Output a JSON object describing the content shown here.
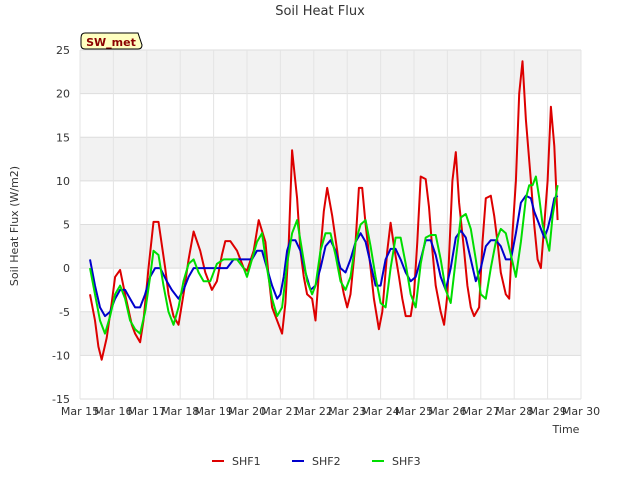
{
  "chart_data": {
    "type": "line",
    "title": "Soil Heat Flux",
    "badge": "SW_met",
    "xlabel": "Time",
    "ylabel": "Soil Heat Flux (W/m2)",
    "xlim": [
      15,
      30
    ],
    "ylim": [
      -15,
      25
    ],
    "x_ticks": [
      15,
      16,
      17,
      18,
      19,
      20,
      21,
      22,
      23,
      24,
      25,
      26,
      27,
      28,
      29,
      30
    ],
    "x_tick_labels": [
      "Mar 15",
      "Mar 16",
      "Mar 17",
      "Mar 18",
      "Mar 19",
      "Mar 20",
      "Mar 21",
      "Mar 22",
      "Mar 23",
      "Mar 24",
      "Mar 25",
      "Mar 26",
      "Mar 27",
      "Mar 28",
      "Mar 29",
      "Mar 30"
    ],
    "y_ticks": [
      -15,
      -10,
      -5,
      0,
      5,
      10,
      15,
      20,
      25
    ],
    "y_tick_labels": [
      "-15",
      "-10",
      "-5",
      "0",
      "5",
      "10",
      "15",
      "20",
      "25"
    ],
    "grid": true,
    "legend_position": "bottom-center",
    "series": [
      {
        "name": "SHF1",
        "color": "#dd0000",
        "x": [
          15.3,
          15.45,
          15.55,
          15.65,
          15.8,
          15.95,
          16.05,
          16.2,
          16.35,
          16.55,
          16.65,
          16.8,
          16.9,
          17.05,
          17.2,
          17.35,
          17.55,
          17.65,
          17.8,
          17.95,
          18.1,
          18.25,
          18.4,
          18.6,
          18.75,
          18.95,
          19.1,
          19.25,
          19.35,
          19.5,
          19.7,
          19.9,
          20.0,
          20.2,
          20.35,
          20.55,
          20.65,
          20.75,
          20.9,
          21.05,
          21.15,
          21.25,
          21.35,
          21.5,
          21.6,
          21.7,
          21.8,
          21.95,
          22.05,
          22.2,
          22.3,
          22.4,
          22.55,
          22.7,
          22.8,
          22.9,
          23.0,
          23.1,
          23.25,
          23.35,
          23.45,
          23.55,
          23.7,
          23.8,
          23.95,
          24.05,
          24.2,
          24.3,
          24.4,
          24.55,
          24.65,
          24.75,
          24.9,
          25.0,
          25.1,
          25.2,
          25.35,
          25.45,
          25.55,
          25.65,
          25.8,
          25.9,
          26.0,
          26.15,
          26.25,
          26.35,
          26.5,
          26.6,
          26.7,
          26.8,
          26.95,
          27.05,
          27.15,
          27.3,
          27.4,
          27.5,
          27.6,
          27.75,
          27.85,
          27.95,
          28.05,
          28.15,
          28.25,
          28.35,
          28.5,
          28.6,
          28.7,
          28.8,
          28.9,
          29.0,
          29.1,
          29.2,
          29.3
        ],
        "y": [
          -3.0,
          -6.0,
          -9.0,
          -10.5,
          -8.0,
          -4.0,
          -1.0,
          -0.2,
          -3.0,
          -6.5,
          -7.5,
          -8.5,
          -6.0,
          0.0,
          5.3,
          5.3,
          0.0,
          -3.0,
          -5.5,
          -6.5,
          -3.0,
          1.0,
          4.2,
          2.0,
          -0.5,
          -2.5,
          -1.5,
          1.5,
          3.1,
          3.1,
          2.0,
          0.0,
          -0.3,
          2.0,
          5.5,
          3.0,
          -1.0,
          -4.5,
          -6.0,
          -7.5,
          -4.0,
          3.0,
          13.5,
          8.0,
          2.0,
          -1.0,
          -3.0,
          -3.5,
          -6.0,
          2.0,
          6.5,
          9.2,
          6.0,
          2.0,
          -1.0,
          -3.0,
          -4.5,
          -3.0,
          3.0,
          9.2,
          9.2,
          5.0,
          0.0,
          -3.5,
          -7.0,
          -5.0,
          2.0,
          5.2,
          2.5,
          -1.0,
          -3.5,
          -5.5,
          -5.5,
          -3.0,
          3.0,
          10.5,
          10.2,
          7.0,
          2.0,
          -2.0,
          -5.0,
          -6.5,
          -3.0,
          10.0,
          13.3,
          7.5,
          2.0,
          -2.0,
          -4.5,
          -5.5,
          -4.5,
          3.0,
          8.0,
          8.3,
          6.0,
          3.0,
          -0.5,
          -3.0,
          -3.5,
          4.0,
          10.0,
          20.0,
          23.7,
          17.0,
          10.0,
          5.0,
          1.0,
          0.0,
          5.0,
          10.0,
          18.5,
          14.0,
          5.5
        ]
      },
      {
        "name": "SHF2",
        "color": "#0000cc",
        "x": [
          15.3,
          15.45,
          15.6,
          15.75,
          15.9,
          16.05,
          16.2,
          16.35,
          16.5,
          16.65,
          16.8,
          16.95,
          17.1,
          17.25,
          17.4,
          17.6,
          17.75,
          17.95,
          18.1,
          18.25,
          18.4,
          18.6,
          18.8,
          19.0,
          19.2,
          19.4,
          19.6,
          19.8,
          20.0,
          20.15,
          20.3,
          20.45,
          20.6,
          20.75,
          20.9,
          21.0,
          21.1,
          21.2,
          21.3,
          21.45,
          21.6,
          21.75,
          21.9,
          22.05,
          22.2,
          22.35,
          22.5,
          22.65,
          22.8,
          22.95,
          23.1,
          23.25,
          23.4,
          23.55,
          23.7,
          23.85,
          24.0,
          24.15,
          24.3,
          24.45,
          24.6,
          24.75,
          24.9,
          25.05,
          25.2,
          25.35,
          25.5,
          25.65,
          25.8,
          25.95,
          26.1,
          26.25,
          26.4,
          26.55,
          26.7,
          26.85,
          27.0,
          27.15,
          27.3,
          27.45,
          27.6,
          27.75,
          27.9,
          28.05,
          28.2,
          28.35,
          28.5,
          28.6,
          28.7,
          28.8,
          28.9,
          29.0,
          29.1,
          29.2,
          29.3
        ],
        "y": [
          1.0,
          -2.0,
          -4.5,
          -5.5,
          -5.0,
          -3.5,
          -2.5,
          -2.5,
          -3.5,
          -4.5,
          -4.5,
          -3.0,
          -1.0,
          0.0,
          0.0,
          -1.5,
          -2.5,
          -3.5,
          -2.5,
          -1.0,
          0.0,
          0.0,
          0.0,
          0.0,
          0.0,
          0.0,
          1.0,
          1.0,
          1.0,
          1.0,
          2.0,
          2.0,
          0.0,
          -2.0,
          -3.5,
          -3.0,
          -1.0,
          2.0,
          3.2,
          3.2,
          2.0,
          -0.5,
          -2.5,
          -2.0,
          0.0,
          2.5,
          3.2,
          2.0,
          0.0,
          -0.5,
          1.0,
          3.0,
          4.0,
          3.0,
          0.5,
          -2.0,
          -2.0,
          1.0,
          2.2,
          2.2,
          1.0,
          -0.5,
          -1.5,
          -1.0,
          1.0,
          3.2,
          3.2,
          1.5,
          -1.0,
          -2.5,
          0.0,
          3.5,
          4.3,
          3.5,
          1.0,
          -1.5,
          0.0,
          2.5,
          3.2,
          3.2,
          2.5,
          1.0,
          1.0,
          4.0,
          7.5,
          8.3,
          8.0,
          6.5,
          5.5,
          4.5,
          3.5,
          4.5,
          6.0,
          8.0,
          8.3
        ]
      },
      {
        "name": "SHF3",
        "color": "#00dd00",
        "x": [
          15.3,
          15.45,
          15.6,
          15.75,
          15.9,
          16.05,
          16.2,
          16.35,
          16.5,
          16.65,
          16.8,
          16.95,
          17.1,
          17.2,
          17.35,
          17.5,
          17.65,
          17.8,
          17.95,
          18.1,
          18.25,
          18.4,
          18.55,
          18.7,
          18.9,
          19.1,
          19.3,
          19.5,
          19.7,
          19.9,
          20.0,
          20.15,
          20.3,
          20.45,
          20.6,
          20.75,
          20.9,
          21.05,
          21.2,
          21.35,
          21.5,
          21.65,
          21.8,
          21.95,
          22.05,
          22.2,
          22.35,
          22.5,
          22.65,
          22.8,
          22.95,
          23.1,
          23.25,
          23.4,
          23.55,
          23.7,
          23.85,
          24.0,
          24.15,
          24.3,
          24.45,
          24.6,
          24.75,
          24.9,
          25.05,
          25.2,
          25.35,
          25.5,
          25.65,
          25.8,
          25.95,
          26.1,
          26.25,
          26.4,
          26.55,
          26.7,
          26.85,
          27.0,
          27.15,
          27.3,
          27.45,
          27.6,
          27.75,
          27.9,
          28.05,
          28.2,
          28.35,
          28.45,
          28.55,
          28.65,
          28.75,
          28.85,
          28.95,
          29.05,
          29.15,
          29.3
        ],
        "y": [
          0.0,
          -3.0,
          -6.0,
          -7.5,
          -5.5,
          -3.0,
          -2.0,
          -3.5,
          -6.0,
          -7.0,
          -7.5,
          -5.0,
          -1.0,
          2.0,
          1.5,
          -2.0,
          -5.0,
          -6.5,
          -4.5,
          -1.5,
          0.5,
          1.0,
          -0.5,
          -1.5,
          -1.5,
          0.5,
          1.0,
          1.0,
          1.0,
          0.0,
          -1.0,
          1.0,
          3.0,
          4.0,
          0.0,
          -3.5,
          -5.5,
          -4.5,
          0.5,
          4.0,
          5.5,
          2.0,
          -1.5,
          -3.0,
          -2.0,
          2.0,
          4.0,
          4.0,
          1.5,
          -1.5,
          -2.5,
          -1.0,
          3.0,
          5.0,
          5.5,
          2.5,
          -1.0,
          -4.0,
          -4.5,
          0.0,
          3.5,
          3.5,
          0.5,
          -3.0,
          -4.5,
          0.5,
          3.5,
          3.8,
          3.8,
          1.0,
          -2.5,
          -4.0,
          1.0,
          5.8,
          6.2,
          4.5,
          1.0,
          -3.0,
          -3.5,
          0.0,
          3.0,
          4.5,
          4.0,
          1.5,
          -1.0,
          3.0,
          8.0,
          9.5,
          9.5,
          10.5,
          8.0,
          5.0,
          3.5,
          2.0,
          6.0,
          9.5
        ]
      }
    ]
  }
}
